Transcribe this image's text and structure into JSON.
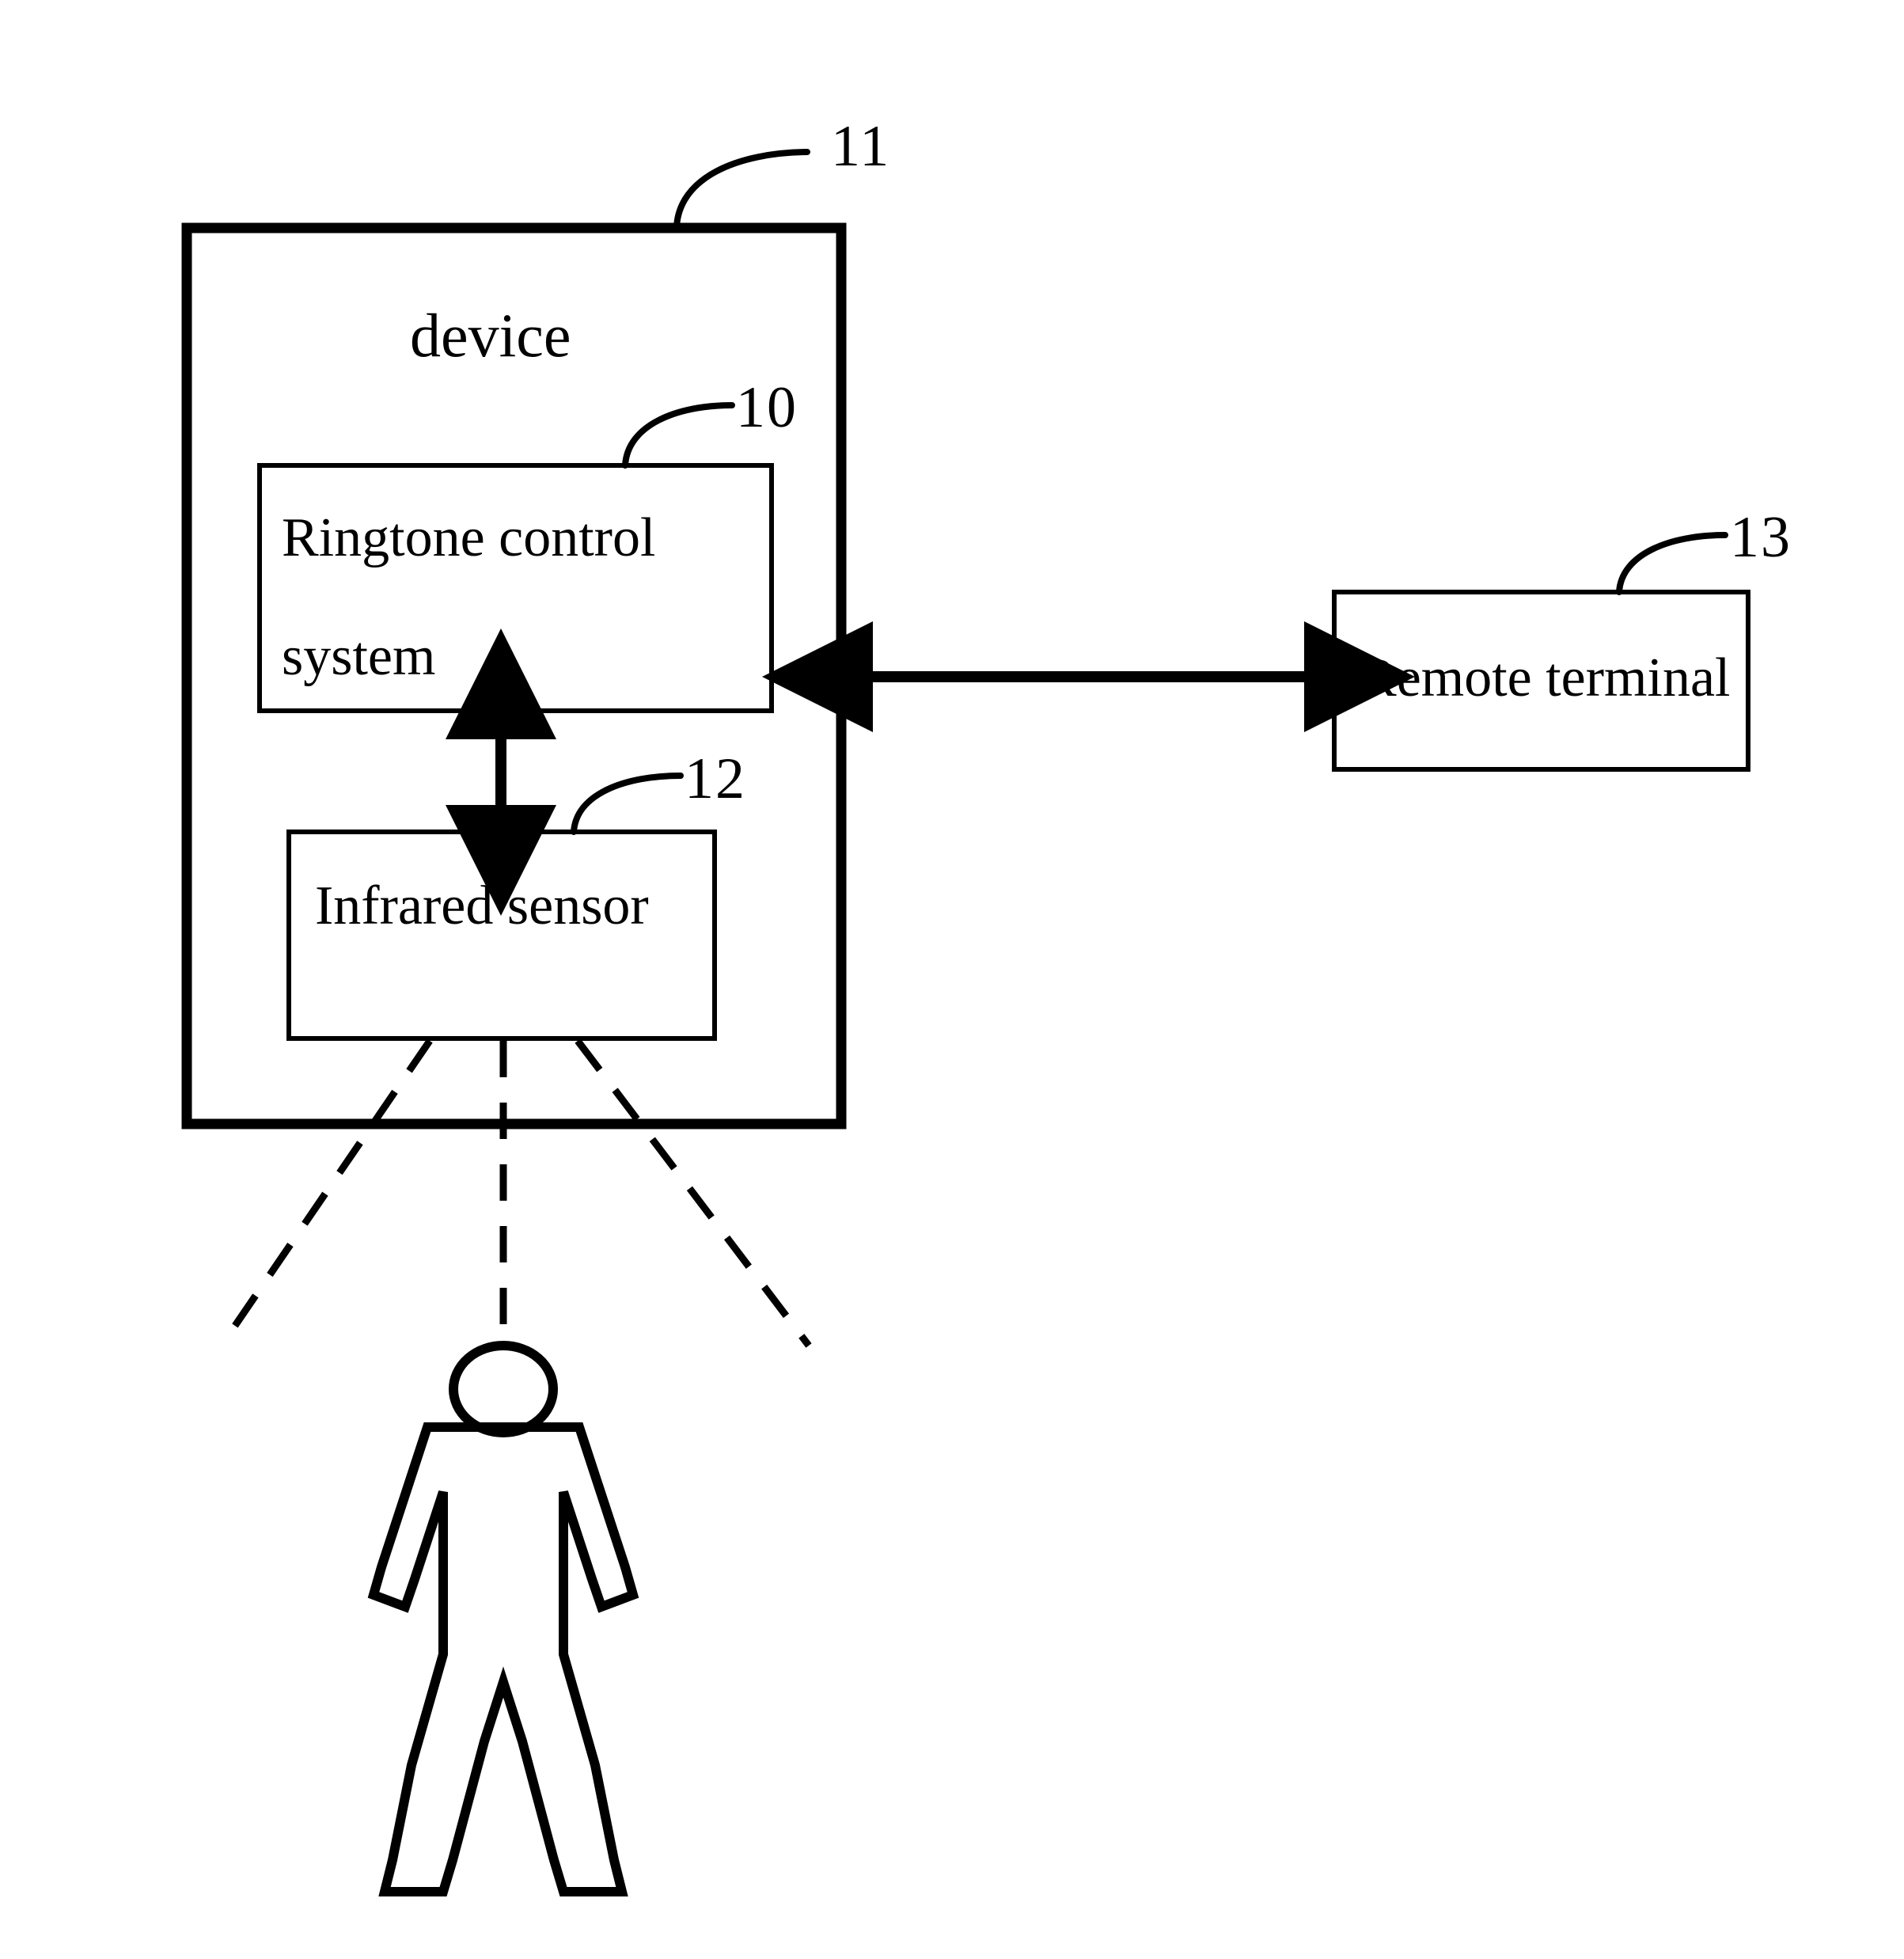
{
  "figure": {
    "type": "patent-block-diagram",
    "background_color": "#ffffff",
    "line_color": "#000000"
  },
  "device_box": {
    "title": "device",
    "reference_numeral": "11"
  },
  "ringtone_box": {
    "title_line1": "Ringtone control",
    "title_line2": "system",
    "reference_numeral": "10"
  },
  "infrared_box": {
    "title": "Infrared sensor",
    "reference_numeral": "12"
  },
  "remote_box": {
    "title": "Remote terminal",
    "reference_numeral": "13"
  },
  "connectors": {
    "device_to_remote": "bidirectional-arrow",
    "ringtone_to_infrared": "bidirectional-arrow",
    "sensor_beams": "dashed-detection-beams"
  },
  "person": {
    "label": "person-pictogram"
  }
}
